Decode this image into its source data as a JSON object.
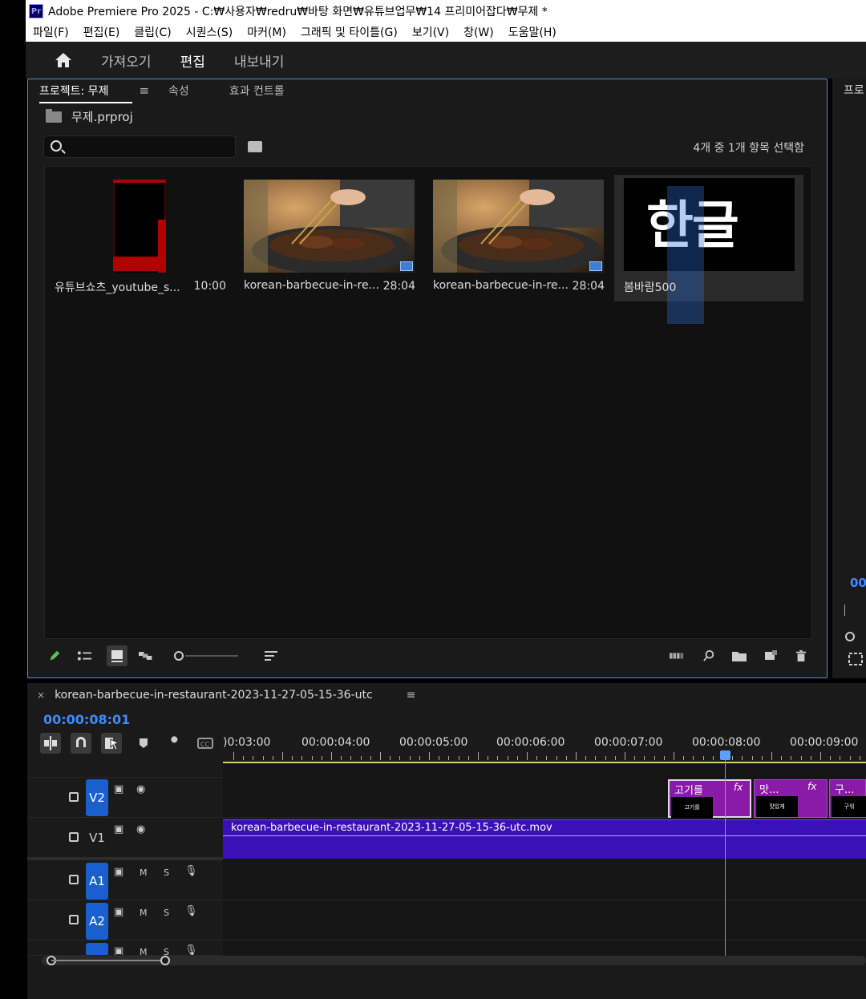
{
  "window": {
    "app_icon": "Pr",
    "title": "Adobe Premiere Pro 2025 - C:₩사용자₩redru₩바탕 화면₩유튜브업무₩14 프리미어잡다₩무제 *"
  },
  "menu": [
    "파일(F)",
    "편집(E)",
    "클립(C)",
    "시퀀스(S)",
    "마커(M)",
    "그래픽 및 타이틀(G)",
    "보기(V)",
    "창(W)",
    "도움말(H)"
  ],
  "workspace": {
    "tabs": [
      {
        "label": "가져오기",
        "active": false
      },
      {
        "label": "편집",
        "active": true
      },
      {
        "label": "내보내기",
        "active": false
      }
    ]
  },
  "project_panel": {
    "tabs": [
      {
        "label": "프로젝트: 무제",
        "active": true
      },
      {
        "label": "속성",
        "active": false
      },
      {
        "label": "효과 컨트롤",
        "active": false
      }
    ],
    "file_name": "무제.prproj",
    "search": {
      "value": "",
      "placeholder": ""
    },
    "selection_status": "4개 중 1개 항목 선택함",
    "clips": [
      {
        "name": "유튜브쇼츠_youtube_s...",
        "duration": "10:00",
        "thumb": "red-black-shorts"
      },
      {
        "name": "korean-barbecue-in-re...",
        "duration": "28:04",
        "thumb": "bbq"
      },
      {
        "name": "korean-barbecue-in-re...",
        "duration": "28:04",
        "thumb": "bbq"
      },
      {
        "name": "봄바람500",
        "duration": "",
        "thumb_text": "한글",
        "selected": true
      }
    ]
  },
  "right_panel": {
    "tab_partial": "프로",
    "timecode_partial": "00"
  },
  "timeline": {
    "sequence_name": "korean-barbecue-in-restaurant-2023-11-27-05-15-36-utc",
    "timecode": "00:00:08:01",
    "ruler_labels": [
      ")0:03:00",
      "00:00:04:00",
      "00:00:05:00",
      "00:00:06:00",
      "00:00:07:00",
      "00:00:08:00",
      "00:00:09:00"
    ],
    "tracks": {
      "v2": {
        "label": "V2",
        "targeted": true
      },
      "v1": {
        "label": "V1",
        "targeted": false
      },
      "a1": {
        "label": "A1",
        "targeted": true,
        "m": "M",
        "s": "S"
      },
      "a2": {
        "label": "A2",
        "targeted": true,
        "m": "M",
        "s": "S"
      },
      "a3": {
        "label": "",
        "m": "M",
        "s": "S"
      }
    },
    "v1_clip": "korean-barbecue-in-restaurant-2023-11-27-05-15-36-utc.mov",
    "v2_clips": [
      {
        "label": "고기를",
        "fx": "fx",
        "thumb": "고기를"
      },
      {
        "label": "맛...",
        "fx": "fx",
        "thumb": "맛있게"
      },
      {
        "label": "구...",
        "fx": "",
        "thumb": "구워"
      }
    ]
  },
  "colors": {
    "accent": "#3d8bff",
    "v1_clip": "#3a10b8",
    "v2_clip": "#8a1aa8",
    "track_target": "#1a5fd0",
    "work_area": "#d6d65a"
  }
}
